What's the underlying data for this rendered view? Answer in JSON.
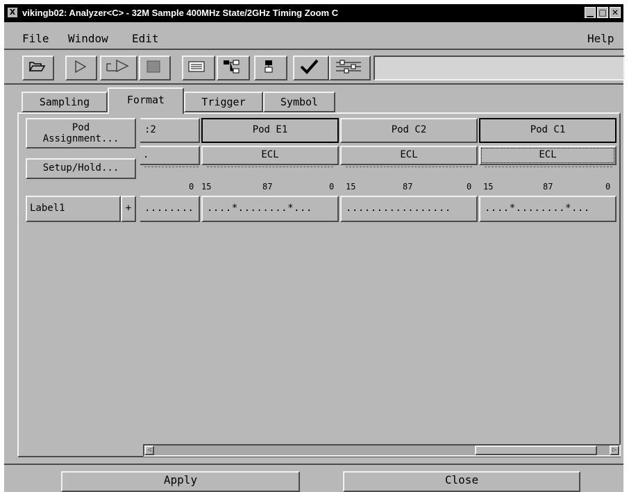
{
  "window": {
    "title": "vikingb02: Analyzer<C> - 32M Sample 400MHz State/2GHz Timing Zoom C",
    "x_icon": "X",
    "controls": [
      "▁",
      "□",
      "✕"
    ]
  },
  "menubar": {
    "file": "File",
    "window": "Window",
    "edit": "Edit",
    "help": "Help"
  },
  "toolbar": {
    "icons": [
      "open-folder-icon",
      "run-icon",
      "run-repetitive-icon",
      "stop-icon",
      "listing-icon",
      "navigator-icon",
      "overview-icon",
      "checkmark-icon",
      "setup-icon"
    ],
    "status_field": ""
  },
  "tabs": [
    {
      "label": "Sampling",
      "active": false
    },
    {
      "label": "Format",
      "active": true
    },
    {
      "label": "Trigger",
      "active": false
    },
    {
      "label": "Symbol",
      "active": false
    }
  ],
  "left_controls": {
    "pod_assignment": "Pod\nAssignment...",
    "setup_hold": "Setup/Hold...",
    "label_name": "Label1",
    "label_plus": "+"
  },
  "pods": [
    {
      "name": ":2",
      "threshold": ".",
      "bits_left": "",
      "bits_mid": "",
      "bits_right": "0",
      "activity": "........"
    },
    {
      "name": "Pod E1",
      "threshold": "ECL",
      "bits_left": "15",
      "bits_mid": "87",
      "bits_right": "0",
      "activity": "....*........*..."
    },
    {
      "name": "Pod C2",
      "threshold": "ECL",
      "bits_left": "15",
      "bits_mid": "87",
      "bits_right": "0",
      "activity": "................."
    },
    {
      "name": "Pod C1",
      "threshold": "ECL",
      "bits_left": "15",
      "bits_mid": "87",
      "bits_right": "0",
      "activity": "....*........*..."
    }
  ],
  "scrollbar": {
    "left_arrow": "◁",
    "right_arrow": "▷"
  },
  "buttons": {
    "apply": "Apply",
    "close": "Close"
  },
  "colors": {
    "background": "#b8b8b8",
    "titlebar": "#000000",
    "highlight": "#f2f2f2",
    "shadow": "#4a4a4a"
  }
}
